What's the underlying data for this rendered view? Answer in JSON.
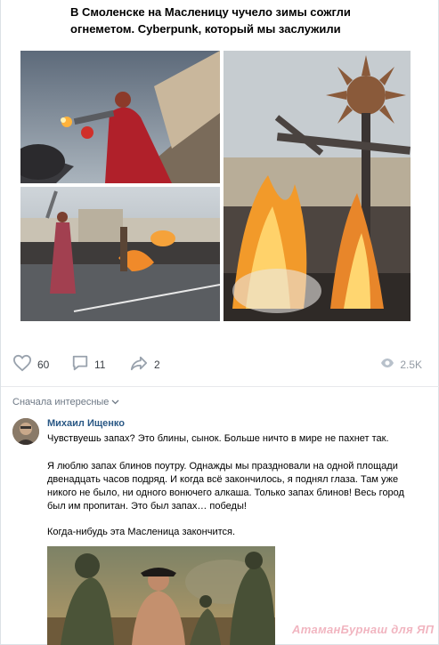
{
  "post": {
    "title": "В Смоленске на Масленицу чучело зимы сожгли огнеметом. Cyberpunk, который мы заслужили"
  },
  "photos": [
    {
      "description_icon": "photo"
    },
    {
      "description_icon": "photo"
    },
    {
      "description_icon": "photo"
    }
  ],
  "actions": {
    "likes": "60",
    "comments": "11",
    "shares": "2",
    "views": "2.5K"
  },
  "comments_section": {
    "sort_label": "Сначала интересные"
  },
  "comment": {
    "author": "Михаил Ищенко",
    "text_1": "Чувствуешь запах? Это блины, сынок. Больше ничто в мире не пахнет так.",
    "text_2": "Я люблю запах блинов поутру. Однажды мы праздновали на одной площади двенадцать часов подряд. И когда всё закончилось, я поднял глаза. Там уже никого не было, ни одного вонючего алкаша. Только запах блинов! Весь город был им пропитан. Это был запах… победы!",
    "text_3": "Когда-нибудь эта Масленица закончится."
  },
  "watermark": "АтаманБурнаш для ЯП",
  "colors": {
    "link": "#2a5885",
    "icon": "#99a2ad",
    "divider": "#e7e8ec"
  }
}
